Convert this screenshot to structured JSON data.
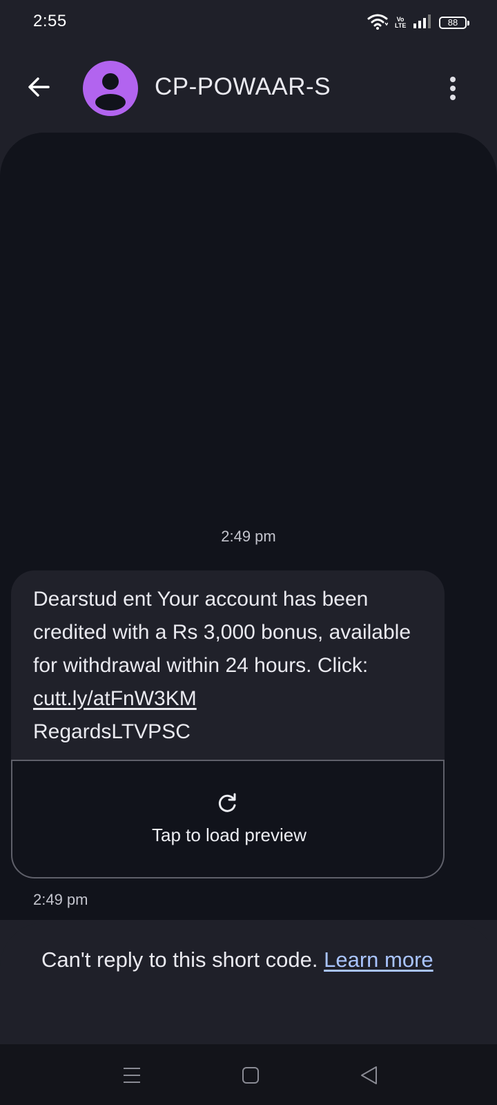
{
  "status_bar": {
    "time": "2:55",
    "network_label_top": "Vo",
    "network_label_bottom": "LTE",
    "battery_level": "88"
  },
  "app_bar": {
    "contact_name": "CP-POWAAR-S",
    "avatar_color": "#b264ef"
  },
  "conversation": {
    "timestamp_top": "2:49 pm",
    "message": {
      "text_before_link": "Dearstud ent Your account has been credited with a Rs 3,000 bonus, available for withdrawal within 24 hours. Click: ",
      "link": "cutt.ly/atFnW3KM",
      "text_after_link": "RegardsLTVPSC"
    },
    "preview_label": "Tap to load preview",
    "timestamp_message": "2:49 pm"
  },
  "notice": {
    "text": "Can't reply to this short code. ",
    "link": "Learn more",
    "link_color": "#a9c4ff"
  },
  "icons": {
    "back": "arrow-left",
    "more": "vertical-ellipsis",
    "refresh": "refresh",
    "wifi": "wifi",
    "signal": "cell-signal",
    "battery": "battery",
    "nav_menu": "three-lines",
    "nav_home": "square",
    "nav_back": "triangle-left"
  }
}
